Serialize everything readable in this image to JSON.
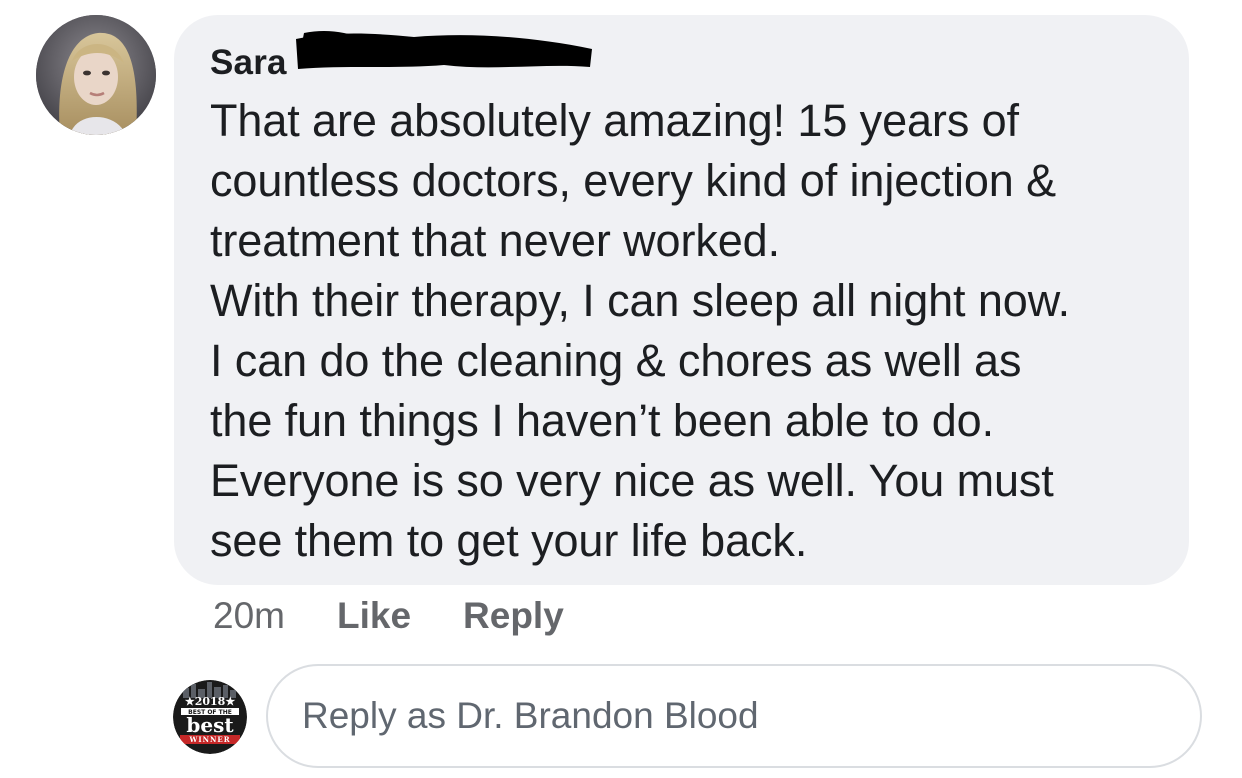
{
  "comment": {
    "author_visible": "Sara",
    "body_lines": [
      "That are absolutely amazing! 15 years of",
      "countless doctors, every kind of injection &",
      "treatment that never worked.",
      "With their therapy, I can sleep all night now.",
      "I can do the cleaning & chores as well as",
      "the fun things I haven’t been able to do.",
      "Everyone is so very nice as well. You must",
      "see them to get your life back."
    ],
    "timestamp": "20m",
    "like_label": "Like",
    "reply_label": "Reply"
  },
  "composer": {
    "placeholder": "Reply as Dr. Brandon Blood",
    "badge": {
      "year": "2018",
      "main": "best",
      "ribbon": "BEST OF THE",
      "banner": "WINNER"
    }
  },
  "colors": {
    "bubble_bg": "#f0f1f4",
    "text_primary": "#1c1e21",
    "text_secondary": "#65676b",
    "input_border": "#dadde1",
    "redaction": "#000000"
  }
}
